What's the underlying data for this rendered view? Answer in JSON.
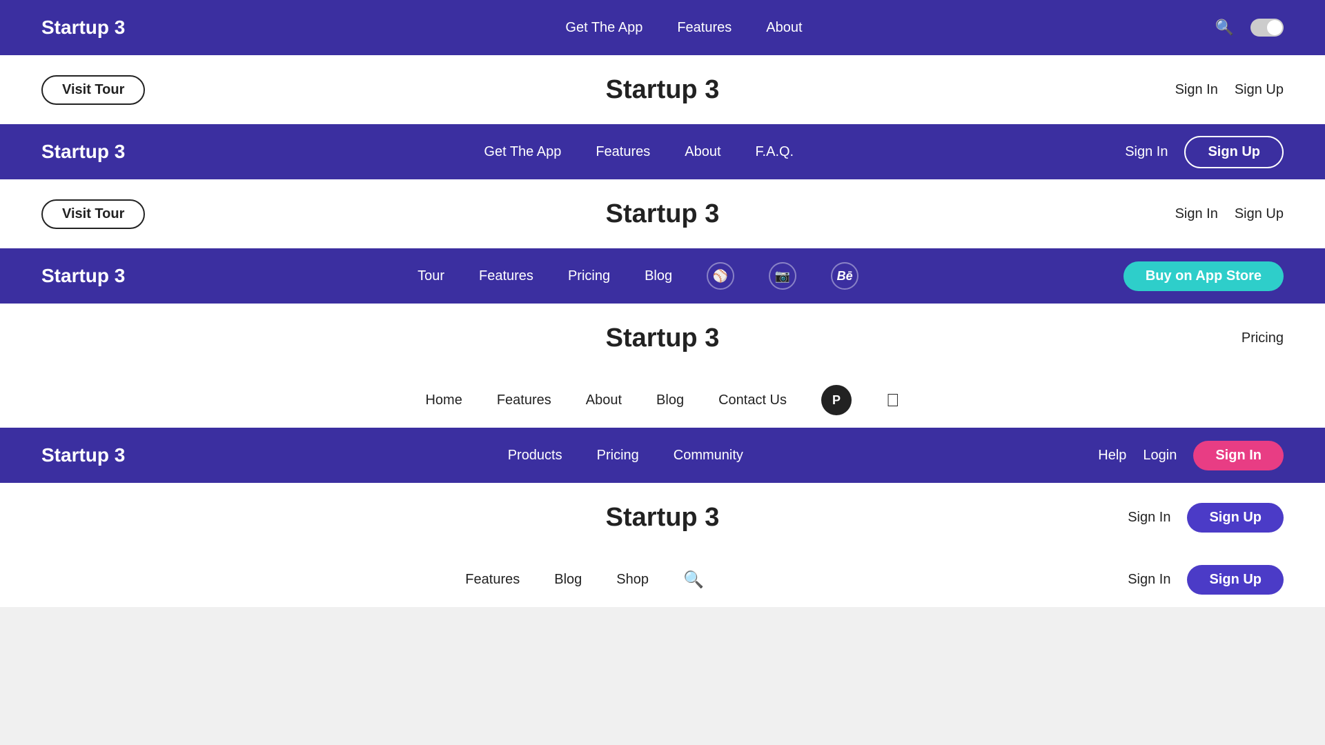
{
  "navbars": [
    {
      "id": "nav1",
      "theme": "dark",
      "logo": "Startup 3",
      "links": [
        "Get The App",
        "Features",
        "About"
      ],
      "hasSearch": true,
      "actions": [],
      "hasToggle": true
    },
    {
      "id": "nav2",
      "theme": "light",
      "logo": "Startup 3",
      "links": [],
      "actions": [
        {
          "label": "Sign In",
          "type": "text"
        },
        {
          "label": "Sign Up",
          "type": "text"
        }
      ]
    },
    {
      "id": "nav3",
      "theme": "dark",
      "logo": "Startup 3",
      "links": [
        "Get The App",
        "Features",
        "About",
        "F.A.Q."
      ],
      "actions": [
        {
          "label": "Sign In",
          "type": "text"
        },
        {
          "label": "Sign Up",
          "type": "btn-outline"
        }
      ]
    },
    {
      "id": "nav4",
      "theme": "light",
      "logo": "Startup 3",
      "links": [],
      "actions": [
        {
          "label": "Sign In",
          "type": "text"
        },
        {
          "label": "Sign Up",
          "type": "text"
        }
      ]
    },
    {
      "id": "nav5",
      "theme": "dark",
      "logo": "Startup 3",
      "links": [
        "Tour",
        "Features",
        "Pricing",
        "Blog"
      ],
      "hasSocial": true,
      "actions": [
        {
          "label": "Buy on App Store",
          "type": "btn-teal"
        }
      ]
    },
    {
      "id": "nav6",
      "theme": "light",
      "logo": "",
      "links": [
        "Home",
        "Features",
        "About",
        "Blog",
        "Contact Us"
      ],
      "hasPIcon": true,
      "hasApple": true,
      "actions": []
    },
    {
      "id": "nav7",
      "theme": "dark",
      "logo": "Startup 3",
      "links": [
        "Products",
        "Pricing",
        "Community"
      ],
      "actions": [
        {
          "label": "Help",
          "type": "text"
        },
        {
          "label": "Login",
          "type": "text"
        },
        {
          "label": "Sign In",
          "type": "btn-pink"
        }
      ]
    },
    {
      "id": "nav8",
      "theme": "light",
      "logo": "",
      "links": [
        "Features",
        "Blog",
        "Shop"
      ],
      "hasSearch": true,
      "actions": [
        {
          "label": "Sign In",
          "type": "text"
        },
        {
          "label": "Sign Up",
          "type": "btn-purple2"
        }
      ]
    }
  ],
  "contentRows": [
    {
      "id": "content1",
      "visitTour": "Visit Tour",
      "title": "Startup 3",
      "rightActions": [
        {
          "label": "Sign In",
          "type": "text"
        },
        {
          "label": "Sign Up",
          "type": "text"
        }
      ]
    },
    {
      "id": "content2",
      "visitTour": "Visit Tour",
      "title": "Startup 3",
      "rightActions": [
        {
          "label": "Sign In",
          "type": "text"
        },
        {
          "label": "Sign Up",
          "type": "text"
        }
      ]
    },
    {
      "id": "content3",
      "title": "Startup 3",
      "pricingBtn": "Pricing",
      "rightActions": []
    },
    {
      "id": "content4",
      "title": "Startup 3",
      "rightActions": []
    }
  ]
}
